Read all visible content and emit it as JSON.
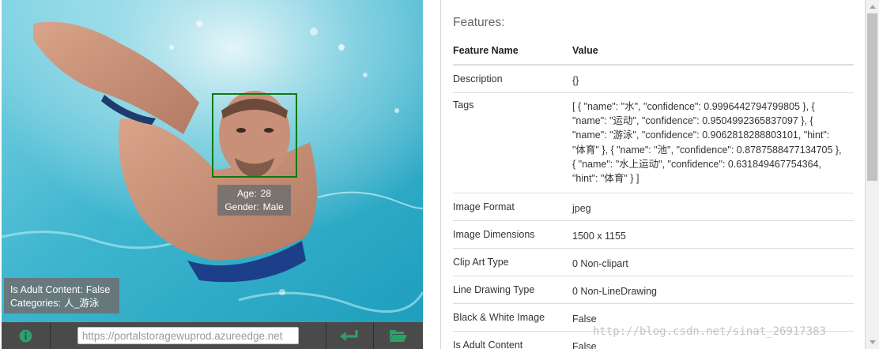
{
  "image": {
    "face": {
      "age_label": "Age:",
      "age_value": "28",
      "gender_label": "Gender:",
      "gender_value": "Male"
    },
    "adult": {
      "adult_label": "Is Adult Content:",
      "adult_value": "False",
      "categories_label": "Categories:",
      "categories_value": "人_游泳"
    }
  },
  "toolbar": {
    "url_value": "https://portalstoragewuprod.azureedge.net",
    "icons": {
      "info": "info-icon",
      "enter": "enter-icon",
      "folder": "folder-open-icon"
    },
    "accent_color": "#2aa06a"
  },
  "features": {
    "heading": "Features:",
    "col_name": "Feature Name",
    "col_value": "Value",
    "rows": [
      {
        "name": "Description",
        "value": "{}"
      },
      {
        "name": "Tags",
        "value": "[ { \"name\": \"水\", \"confidence\": 0.9996442794799805 }, { \"name\": \"运动\", \"confidence\": 0.9504992365837097 }, { \"name\": \"游泳\", \"confidence\": 0.9062818288803101, \"hint\": \"体育\" }, { \"name\": \"池\", \"confidence\": 0.8787588477134705 }, { \"name\": \"水上运动\", \"confidence\": 0.631849467754364, \"hint\": \"体育\" } ]"
      },
      {
        "name": "Image Format",
        "value": "jpeg"
      },
      {
        "name": "Image Dimensions",
        "value": "1500 x 1155"
      },
      {
        "name": "Clip Art Type",
        "value": "0 Non-clipart"
      },
      {
        "name": "Line Drawing Type",
        "value": "0 Non-LineDrawing"
      },
      {
        "name": "Black & White Image",
        "value": "False"
      },
      {
        "name": "Is Adult Content",
        "value": "False"
      }
    ]
  },
  "watermark": "http://blog.csdn.net/sinat_26917383",
  "colors": {
    "face_box": "#0e7a0e",
    "water": "#3fb6cf",
    "toolbar": "#4a4a4a"
  }
}
